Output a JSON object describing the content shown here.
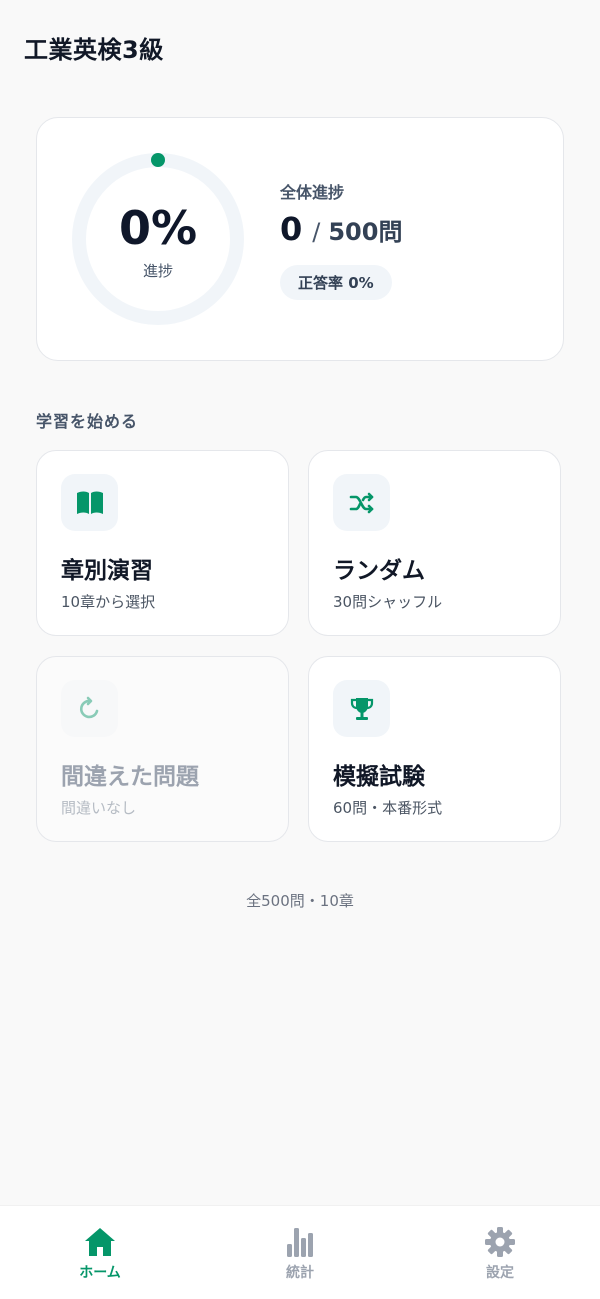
{
  "header": {
    "title": "工業英検3級"
  },
  "progress": {
    "percent_text": "0%",
    "percent_label": "進捗",
    "overall_label": "全体進捗",
    "completed": "0",
    "separator": "/",
    "total": "500問",
    "accuracy": "正答率 0%",
    "progress_fraction": 0,
    "accent_color": "#059669"
  },
  "section": {
    "heading": "学習を始める"
  },
  "modes": [
    {
      "title": "章別演習",
      "subtitle": "10章から選択",
      "icon": "book-icon",
      "enabled": true
    },
    {
      "title": "ランダム",
      "subtitle": "30問シャッフル",
      "icon": "shuffle-icon",
      "enabled": true
    },
    {
      "title": "間違えた問題",
      "subtitle": "間違いなし",
      "icon": "refresh-icon",
      "enabled": false
    },
    {
      "title": "模擬試験",
      "subtitle": "60問・本番形式",
      "icon": "trophy-icon",
      "enabled": true
    }
  ],
  "footer": {
    "note": "全500問・10章"
  },
  "tabs": [
    {
      "label": "ホーム",
      "icon": "home-icon",
      "active": true
    },
    {
      "label": "統計",
      "icon": "bar-chart-icon",
      "active": false
    },
    {
      "label": "設定",
      "icon": "gear-icon",
      "active": false
    }
  ],
  "colors": {
    "accent": "#059669",
    "inactive": "#9ca3af"
  }
}
